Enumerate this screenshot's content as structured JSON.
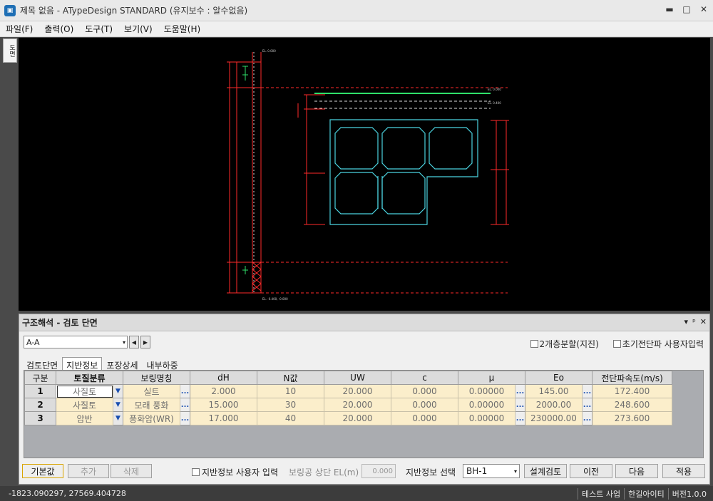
{
  "window": {
    "title": "제목 없음 - ATypeDesign STANDARD  (유지보수 : 알수없음)",
    "app_icon": "window-icon",
    "minimize": "▬",
    "maximize": "□",
    "close": "✕"
  },
  "menu": [
    "파일(F)",
    "출력(O)",
    "도구(T)",
    "보기(V)",
    "도움말(H)"
  ],
  "left_tab": "도면",
  "canvas": {
    "bg": "#000000",
    "labels": {
      "gl": "EL. 0.000",
      "wl": "EL. 0.400",
      "bot": "EL. -0.400, -0.000",
      "top_small": "EL. 0.000"
    }
  },
  "panel": {
    "title": "구조해석 - 검토 단면",
    "header_controls": [
      "▾",
      "ᵖ",
      "✕"
    ],
    "section_select": "A-A",
    "section_arrow": "▾",
    "nav_prev": "◀",
    "nav_next": "▶",
    "checkbox_split": "2개층분할(지진)",
    "checkbox_initial": "초기전단파 사용자입력",
    "tabs": [
      "검토단면",
      "지반정보",
      "포장상세",
      "내부하중"
    ],
    "active_tab": 1,
    "grid": {
      "headers": [
        "구분",
        "토질분류",
        "보링명칭",
        "dH",
        "N값",
        "UW",
        "c",
        "μ",
        "Eo",
        "전단파속도(m/s)"
      ],
      "rows": [
        {
          "idx": "1",
          "soil": "사질토",
          "boring": "실트",
          "dH": "2.000",
          "N": "10",
          "UW": "20.000",
          "c": "0.000",
          "mu": "0.00000",
          "Eo": "145.00",
          "Vs": "172.400"
        },
        {
          "idx": "2",
          "soil": "사질토",
          "boring": "모래 풍화",
          "dH": "15.000",
          "N": "30",
          "UW": "20.000",
          "c": "0.000",
          "mu": "0.00000",
          "Eo": "2000.00",
          "Vs": "248.600"
        },
        {
          "idx": "3",
          "soil": "암반",
          "boring": "풍화암(WR)",
          "dH": "17.000",
          "N": "40",
          "UW": "20.000",
          "c": "0.000",
          "mu": "0.00000",
          "Eo": "230000.00",
          "Vs": "273.600"
        }
      ],
      "drop_glyph": "▼",
      "dots_glyph": "..."
    },
    "buttons": {
      "default": "기본값",
      "add": "추가",
      "delete": "삭제",
      "user_input": "지반정보 사용자 입력",
      "boring_top_label": "보링공 상단 EL(m)",
      "boring_top_value": "0.000",
      "select_label": "지반정보 선택",
      "select_value": "BH-1",
      "select_arrow": "▾",
      "design_check": "설계검토",
      "prev": "이전",
      "next": "다음",
      "apply": "적용"
    }
  },
  "status": {
    "coords": "-1823.090297,   27569.404728",
    "items": [
      "테스트 사업",
      "한길아이티",
      "버전1.0.0"
    ]
  }
}
